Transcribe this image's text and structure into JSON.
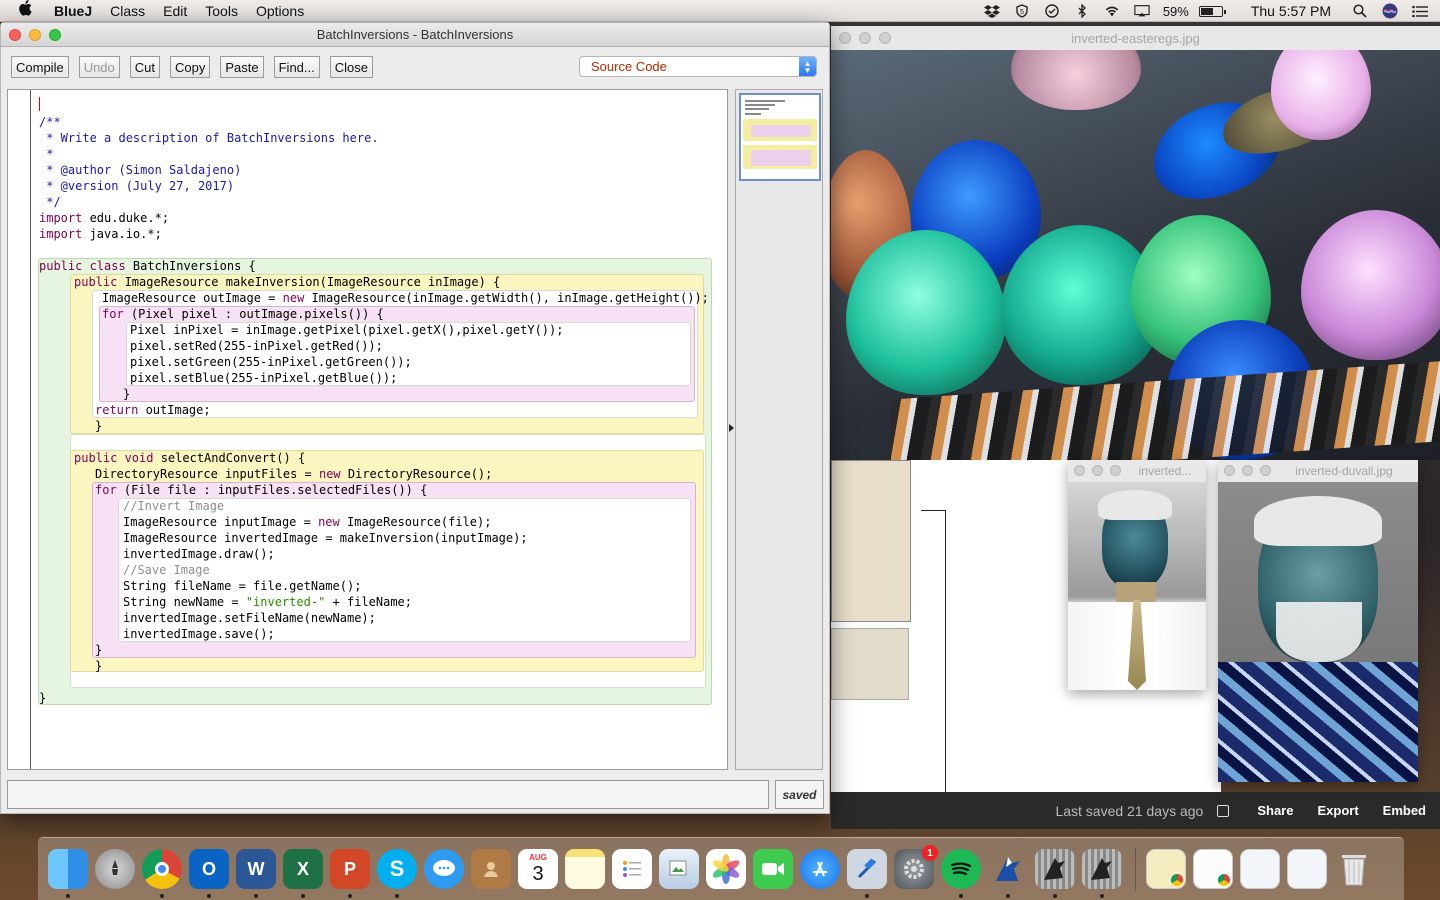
{
  "menubar": {
    "apple": "",
    "app_name": "BlueJ",
    "menus": [
      "Class",
      "Edit",
      "Tools",
      "Options"
    ],
    "battery": "59%",
    "clock": "Thu 5:57 PM"
  },
  "bluej": {
    "title": "BatchInversions - BatchInversions",
    "toolbar": {
      "compile": "Compile",
      "undo": "Undo",
      "cut": "Cut",
      "copy": "Copy",
      "paste": "Paste",
      "find": "Find...",
      "close": "Close"
    },
    "view_select": "Source Code",
    "status": "saved"
  },
  "code": {
    "l1": "/**",
    "l2": " * Write a description of BatchInversions here.",
    "l3": " *",
    "l4": " * @author (Simon Saldajeno)",
    "l5": " * @version (July 27, 2017)",
    "l6": " */",
    "l7_kw": "import",
    "l7_rest": " edu.duke.*;",
    "l8_kw": "import",
    "l8_rest": " java.io.*;",
    "l10_kw": "public class",
    "l10_rest": " BatchInversions {",
    "l11_kw": "public",
    "l11_rest": " ImageResource makeInversion(ImageResource inImage) {",
    "l12_a": "ImageResource outImage = ",
    "l12_kw": "new",
    "l12_b": " ImageResource(inImage.getWidth(), inImage.getHeight());",
    "l13_kw": "for",
    "l13_rest": " (Pixel pixel : outImage.pixels()) {",
    "l14": "Pixel inPixel = inImage.getPixel(pixel.getX(),pixel.getY());",
    "l15": "pixel.setRed(255-inPixel.getRed());",
    "l16": "pixel.setGreen(255-inPixel.getGreen());",
    "l17": "pixel.setBlue(255-inPixel.getBlue());",
    "l18": "}",
    "l19_kw": "return",
    "l19_rest": " outImage;",
    "l20": "}",
    "l22_kw": "public void",
    "l22_rest": " selectAndConvert() {",
    "l23_a": "DirectoryResource inputFiles = ",
    "l23_kw": "new",
    "l23_b": " DirectoryResource();",
    "l24_kw": "for",
    "l24_rest": " (File file : inputFiles.selectedFiles()) {",
    "l25": "//Invert Image",
    "l26_a": "ImageResource inputImage = ",
    "l26_kw": "new",
    "l26_b": " ImageResource(file);",
    "l27": "ImageResource invertedImage = makeInversion(inputImage);",
    "l28": "invertedImage.draw();",
    "l29": "//Save Image",
    "l30": "String fileName = file.getName();",
    "l31_a": "String newName = ",
    "l31_str": "\"inverted-\"",
    "l31_b": " + fileName;",
    "l32": "invertedImage.setFileName(newName);",
    "l33": "invertedImage.save();",
    "l34": "}",
    "l35": "}",
    "l37": "}"
  },
  "viewers": {
    "eggs_title": "inverted-easteregs.jpg",
    "small1_title": "inverted...",
    "small2_title": "inverted-duvall.jpg"
  },
  "flickr": {
    "last_saved": "Last saved 21 days ago",
    "share": "Share",
    "export": "Export",
    "embed": "Embed"
  },
  "dock": {
    "calendar_month": "AUG",
    "calendar_day": "3",
    "sys_prefs_badge": "1",
    "apps": [
      "Finder",
      "Launchpad",
      "Google Chrome",
      "Outlook",
      "Word",
      "Excel",
      "PowerPoint",
      "Skype",
      "Messages",
      "Contacts",
      "Calendar",
      "Notes",
      "Reminders",
      "Preview",
      "Photos",
      "FaceTime",
      "App Store",
      "Xcode",
      "System Preferences",
      "Spotify",
      "BlueJ",
      "BlueJ project",
      "BlueJ project 2",
      "Downloads",
      "Documents",
      "Desktop",
      "Folder",
      "Trash"
    ]
  },
  "colors": {
    "scope_class": "#e6f5e0",
    "scope_method": "#fbf6c0",
    "scope_loop": "#f7e2f5",
    "comment": "#1a1aa6",
    "keyword": "#7f0055",
    "string": "#2a8a00"
  }
}
